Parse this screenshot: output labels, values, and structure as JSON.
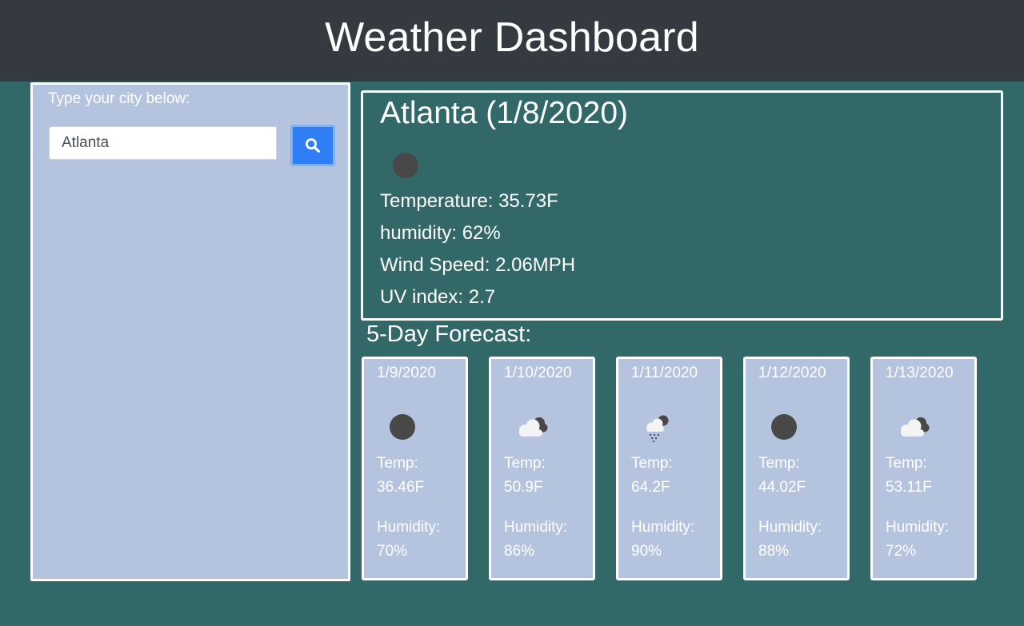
{
  "header": {
    "title": "Weather Dashboard"
  },
  "search": {
    "label": "Type your city below:",
    "value": "Atlanta",
    "button_icon": "search-icon"
  },
  "current": {
    "title": "Atlanta (1/8/2020)",
    "icon": "moon-icon",
    "temperature": "Temperature: 35.73F",
    "humidity": "humidity: 62%",
    "wind": "Wind Speed: 2.06MPH",
    "uv": "UV index: 2.7"
  },
  "forecast": {
    "title": "5-Day Forecast:",
    "days": [
      {
        "date": "1/9/2020",
        "icon": "moon-icon",
        "temp_label": "Temp:",
        "temp": "36.46F",
        "humidity_label": "Humidity:",
        "humidity": "70%"
      },
      {
        "date": "1/10/2020",
        "icon": "cloud-night-icon",
        "temp_label": "Temp:",
        "temp": "50.9F",
        "humidity_label": "Humidity:",
        "humidity": "86%"
      },
      {
        "date": "1/11/2020",
        "icon": "rain-night-icon",
        "temp_label": "Temp:",
        "temp": "64.2F",
        "humidity_label": "Humidity:",
        "humidity": "90%"
      },
      {
        "date": "1/12/2020",
        "icon": "moon-icon",
        "temp_label": "Temp:",
        "temp": "44.02F",
        "humidity_label": "Humidity:",
        "humidity": "88%"
      },
      {
        "date": "1/13/2020",
        "icon": "cloud-night-icon",
        "temp_label": "Temp:",
        "temp": "53.11F",
        "humidity_label": "Humidity:",
        "humidity": "72%"
      }
    ]
  },
  "colors": {
    "background": "#336868",
    "header": "#343a40",
    "panel": "#b5c4de",
    "button": "#2f7ef6"
  }
}
